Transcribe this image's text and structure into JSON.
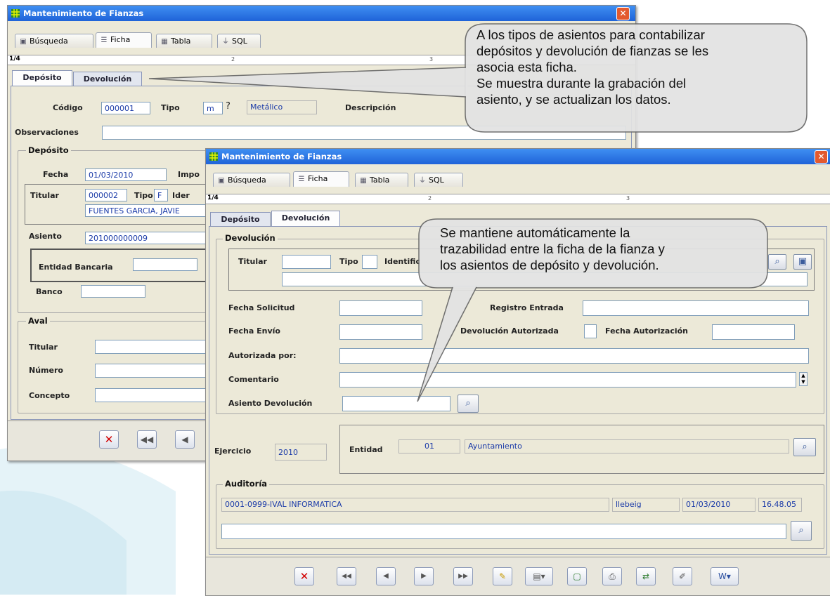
{
  "window1": {
    "title": "Mantenimiento de Fianzas",
    "tabs": [
      "Búsqueda",
      "Ficha",
      "Tabla",
      "SQL"
    ],
    "ruler": "1/4",
    "subtabs": [
      "Depósito",
      "Devolución"
    ],
    "codigo_label": "Código",
    "codigo": "000001",
    "tipo_label": "Tipo",
    "tipo": "m",
    "tipo_q": "?",
    "tipo_desc": "Metálico",
    "descripcion_label": "Descripción",
    "observaciones_label": "Observaciones",
    "deposito": {
      "title": "Depósito",
      "fecha_label": "Fecha",
      "fecha": "01/03/2010",
      "importe_label": "Impo",
      "titular_label": "Titular",
      "titular_code": "000002",
      "tipo_label": "Tipo",
      "tipo": "F",
      "ident_label": "Ider",
      "titular_name": "FUENTES GARCIA, JAVIE",
      "asiento_label": "Asiento",
      "asiento": "201000000009",
      "entidad_label": "Entidad Bancaria",
      "banco_label": "Banco"
    },
    "aval": {
      "title": "Aval",
      "titular_label": "Titular",
      "numero_label": "Número",
      "concepto_label": "Concepto"
    }
  },
  "window2": {
    "title": "Mantenimiento de Fianzas",
    "tabs": [
      "Búsqueda",
      "Ficha",
      "Tabla",
      "SQL"
    ],
    "ruler": "1/4",
    "subtabs": [
      "Depósito",
      "Devolución"
    ],
    "devolucion": {
      "title": "Devolución",
      "titular_label": "Titular",
      "tipo_label": "Tipo",
      "ident_label": "Identific",
      "fecha_solicitud_label": "Fecha Solicitud",
      "registro_label": "Registro Entrada",
      "fecha_envio_label": "Fecha Envío",
      "autorizada_label": "Devolución Autorizada",
      "fecha_autorizacion_label": "Fecha Autorización",
      "autorizada_por_label": "Autorizada por:",
      "comentario_label": "Comentario",
      "asiento_label": "Asiento Devolución"
    },
    "ejercicio_label": "Ejercicio",
    "ejercicio": "2010",
    "entidad_label": "Entidad",
    "entidad_code": "01",
    "entidad_name": "Ayuntamiento",
    "auditoria": {
      "title": "Auditoría",
      "empresa": "0001-0999-IVAL INFORMATICA",
      "usuario": "llebeig",
      "fecha": "01/03/2010",
      "hora": "16.48.05"
    }
  },
  "callout1": {
    "lines": [
      "A los tipos de asientos para contabilizar",
      "depósitos y devolución de fianzas se les",
      "asocia esta ficha.",
      "Se muestra durante la grabación del",
      "asiento, y se actualizan los datos."
    ]
  },
  "callout2": {
    "lines": [
      "Se mantiene automáticamente la",
      "trazabilidad entre la ficha de la fianza y",
      "los asientos de depósito y devolución."
    ]
  },
  "icons": {
    "app": "app-grid-icon",
    "busqueda": "binoculars-icon",
    "ficha": "form-icon",
    "tabla": "table-icon",
    "sql": "filter-icon",
    "search": "magnifier-icon"
  }
}
